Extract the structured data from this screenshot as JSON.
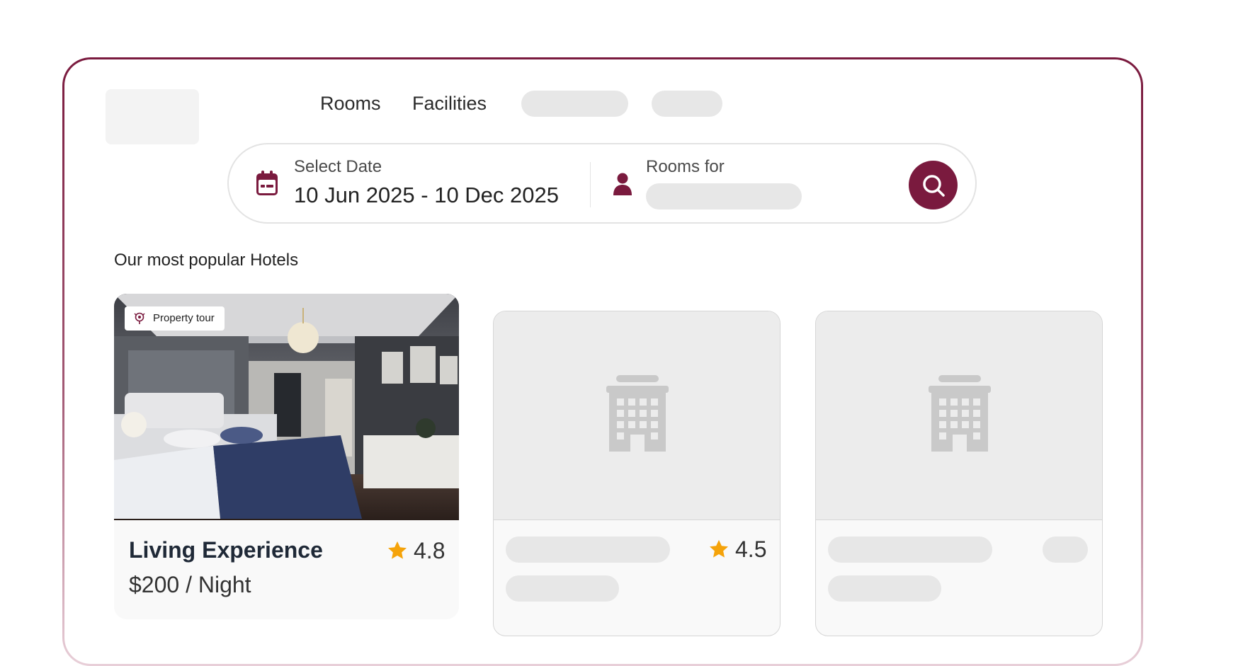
{
  "nav": {
    "links": [
      "Rooms",
      "Facilities"
    ]
  },
  "search": {
    "date_label": "Select Date",
    "date_value": "10 Jun 2025 - 10 Dec 2025",
    "rooms_label": "Rooms for"
  },
  "section": {
    "title": "Our most popular Hotels"
  },
  "cards": [
    {
      "badge": "Property tour",
      "title": "Living Experience",
      "price": "$200 / Night",
      "rating": "4.8"
    },
    {
      "rating": "4.5"
    },
    {}
  ],
  "icons": {
    "calendar": "calendar-icon",
    "person": "person-icon",
    "search": "search-icon",
    "tour": "property-tour-icon",
    "star": "star-icon",
    "building": "building-icon"
  },
  "colors": {
    "brand": "#7a1a3e",
    "star": "#f5a30a",
    "placeholder": "#e7e7e7"
  }
}
